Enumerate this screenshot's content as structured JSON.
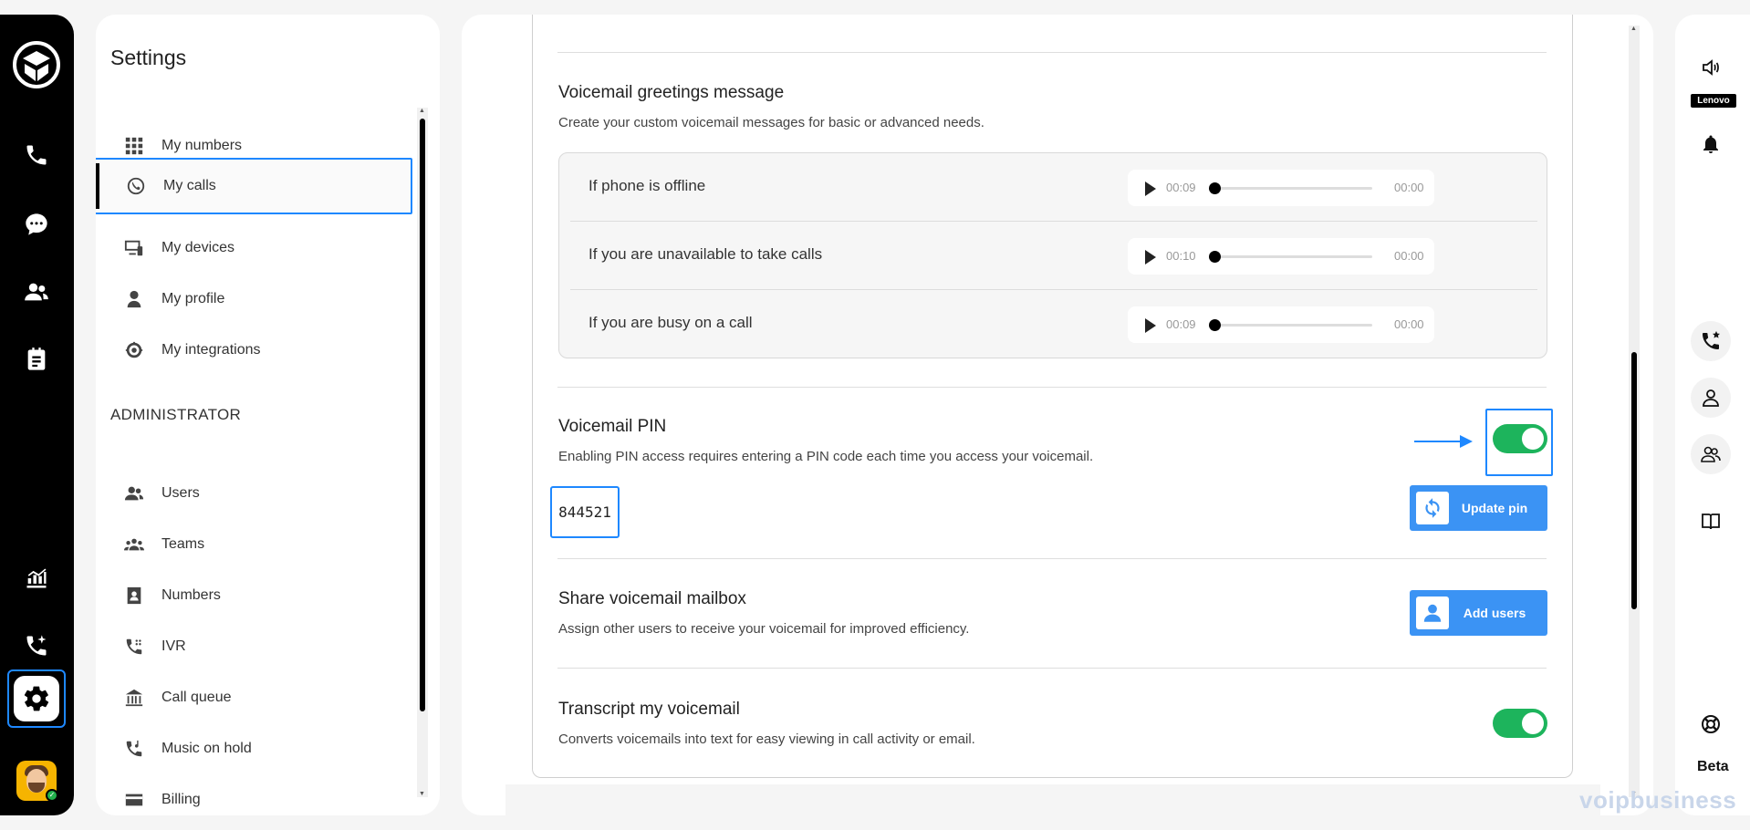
{
  "sidebar": {
    "title": "Settings",
    "items": [
      {
        "label": "My numbers",
        "icon": "grid-icon"
      },
      {
        "label": "My calls",
        "icon": "call-settings-icon",
        "active": true
      },
      {
        "label": "My devices",
        "icon": "devices-icon"
      },
      {
        "label": "My profile",
        "icon": "user-icon"
      },
      {
        "label": "My integrations",
        "icon": "integrations-icon"
      }
    ],
    "admin_label": "ADMINISTRATOR",
    "admin_items": [
      {
        "label": "Users",
        "icon": "users-icon"
      },
      {
        "label": "Teams",
        "icon": "teams-icon"
      },
      {
        "label": "Numbers",
        "icon": "contact-card-icon"
      },
      {
        "label": "IVR",
        "icon": "ivr-icon"
      },
      {
        "label": "Call queue",
        "icon": "call-queue-icon"
      },
      {
        "label": "Music on hold",
        "icon": "music-on-hold-icon"
      },
      {
        "label": "Billing",
        "icon": "billing-icon"
      }
    ]
  },
  "greetings": {
    "title": "Voicemail greetings message",
    "description": "Create your custom voicemail messages for basic or advanced needs.",
    "rows": [
      {
        "label": "If phone is offline",
        "duration": "00:09",
        "position": "00:00"
      },
      {
        "label": "If you are unavailable to take calls",
        "duration": "00:10",
        "position": "00:00"
      },
      {
        "label": "If you are busy on a call",
        "duration": "00:09",
        "position": "00:00"
      }
    ]
  },
  "pin": {
    "title": "Voicemail PIN",
    "description": "Enabling PIN access requires entering a PIN code each time you access your voicemail.",
    "value": "844521",
    "enabled": true,
    "update_label": "Update pin"
  },
  "share": {
    "title": "Share voicemail mailbox",
    "description": "Assign other users to receive your voicemail for improved efficiency.",
    "button_label": "Add users"
  },
  "transcript": {
    "title": "Transcript my voicemail",
    "description": "Converts voicemails into text for easy viewing in call activity or email.",
    "enabled": true
  },
  "right_bar": {
    "device_label": "Lenovo",
    "beta_label": "Beta"
  },
  "watermark": "voipbusiness",
  "colors": {
    "accent": "#1e88ff",
    "button": "#3b93f4",
    "toggle_on": "#1db45c"
  }
}
